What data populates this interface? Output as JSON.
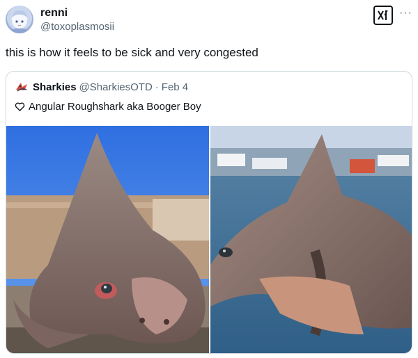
{
  "author": {
    "display_name": "renni",
    "handle": "@toxoplasmosii",
    "avatar_icon": "anime-avatar"
  },
  "tweet": {
    "text": "this is how it feels to be sick and very congested"
  },
  "toolbar": {
    "grok_icon": "grok-icon",
    "more_label": "···"
  },
  "quote": {
    "avatar_icon": "shark-logo",
    "display_name": "Sharkies",
    "handle": "@SharkiesOTD",
    "separator": "·",
    "date": "Feb 4",
    "text": "Angular Roughshark aka Booger Boy",
    "text_icon": "heart-outline-icon",
    "media": [
      {
        "name": "roughshark-photo-closeup",
        "description_icon": "image"
      },
      {
        "name": "roughshark-photo-harbor",
        "description_icon": "image"
      }
    ]
  },
  "colors": {
    "text_primary": "#0f1419",
    "text_secondary": "#536471",
    "border": "#cfd9de"
  }
}
